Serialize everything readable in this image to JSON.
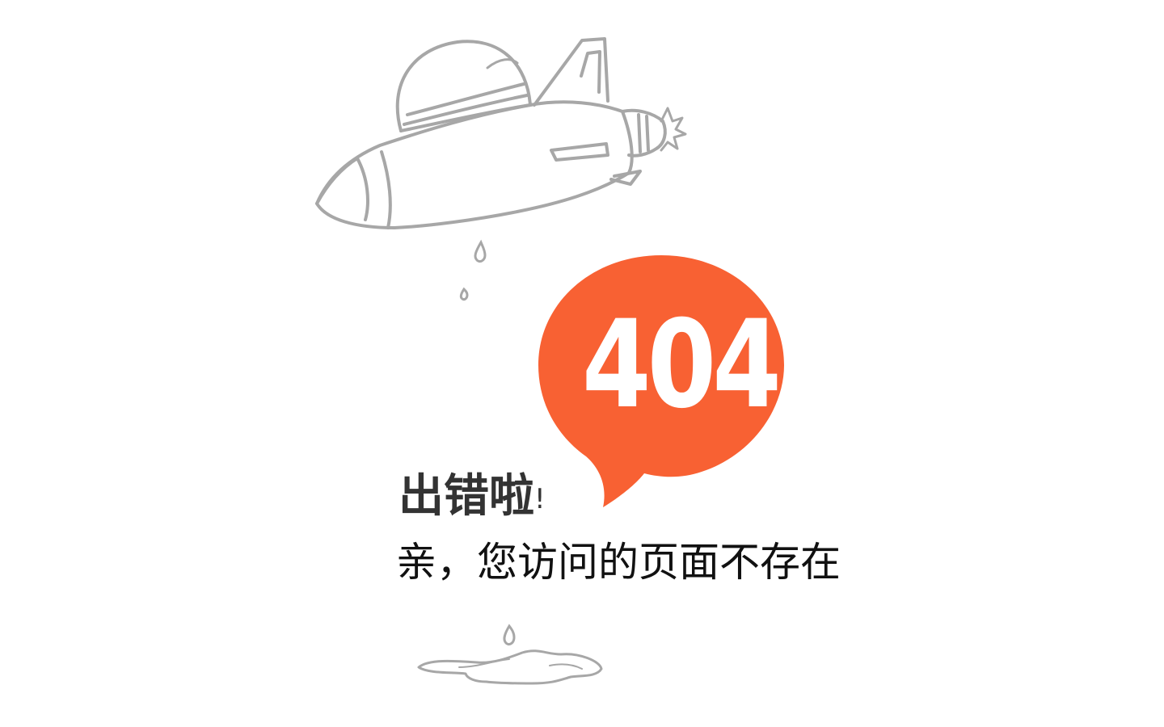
{
  "error": {
    "code": "404",
    "headline": "出错啦",
    "headline_mark": "!",
    "message": "亲，您访问的页面不存在"
  },
  "colors": {
    "bubble": "#F86133",
    "sketch": "#A7A7A7",
    "text_dark": "#111111"
  },
  "icons": {
    "illustration": "rocket-ship-sketch",
    "bubble": "speech-bubble",
    "puddle": "water-puddle"
  }
}
